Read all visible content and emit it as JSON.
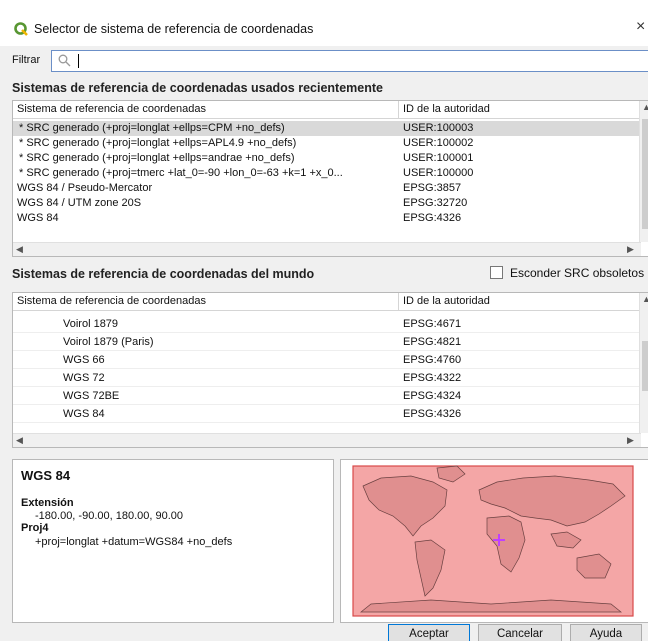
{
  "window": {
    "title": "Selector de sistema de referencia de coordenadas",
    "close_glyph": "×"
  },
  "filter": {
    "label": "Filtrar",
    "value": "",
    "placeholder": "",
    "icon": "search-icon"
  },
  "recent": {
    "section_title": "Sistemas de referencia de coordenadas usados recientemente",
    "columns": [
      "Sistema de referencia de coordenadas",
      "ID de la autoridad"
    ],
    "rows": [
      {
        "name": " * SRC generado (+proj=longlat +ellps=CPM +no_defs)",
        "id": "USER:100003",
        "selected": true
      },
      {
        "name": " * SRC generado (+proj=longlat +ellps=APL4.9 +no_defs)",
        "id": "USER:100002",
        "selected": false
      },
      {
        "name": " * SRC generado (+proj=longlat +ellps=andrae +no_defs)",
        "id": "USER:100001",
        "selected": false
      },
      {
        "name": " * SRC generado (+proj=tmerc +lat_0=-90 +lon_0=-63 +k=1 +x_0...",
        "id": "USER:100000",
        "selected": false
      },
      {
        "name": "WGS 84 / Pseudo-Mercator",
        "id": "EPSG:3857",
        "selected": false
      },
      {
        "name": "WGS 84 / UTM zone 20S",
        "id": "EPSG:32720",
        "selected": false
      },
      {
        "name": "WGS 84",
        "id": "EPSG:4326",
        "selected": false
      }
    ]
  },
  "world": {
    "section_title": "Sistemas de referencia de coordenadas del mundo",
    "hide_deprecated_label": "Esconder SRC obsoletos",
    "hide_deprecated_checked": false,
    "columns": [
      "Sistema de referencia de coordenadas",
      "ID de la autoridad"
    ],
    "rows": [
      {
        "name": "Voirol 1879",
        "id": "EPSG:4671"
      },
      {
        "name": "Voirol 1879 (Paris)",
        "id": "EPSG:4821"
      },
      {
        "name": "WGS 66",
        "id": "EPSG:4760"
      },
      {
        "name": "WGS 72",
        "id": "EPSG:4322"
      },
      {
        "name": "WGS 72BE",
        "id": "EPSG:4324"
      },
      {
        "name": "WGS 84",
        "id": "EPSG:4326"
      }
    ]
  },
  "details": {
    "crs_name": "WGS 84",
    "extent_label": "Extensión",
    "extent_value": "-180.00, -90.00, 180.00, 90.00",
    "proj4_label": "Proj4",
    "proj4_value": "+proj=longlat +datum=WGS84 +no_defs"
  },
  "map": {
    "extent_fill": "#f4a6a6",
    "extent_stroke": "#d84a4a",
    "marker_color": "#c040ff"
  },
  "buttons": {
    "accept": "Aceptar",
    "cancel": "Cancelar",
    "help": "Ayuda"
  },
  "colors": {
    "qgis_green": "#589632",
    "selection": "#d9d9d9",
    "focus_border": "#0078d7"
  }
}
